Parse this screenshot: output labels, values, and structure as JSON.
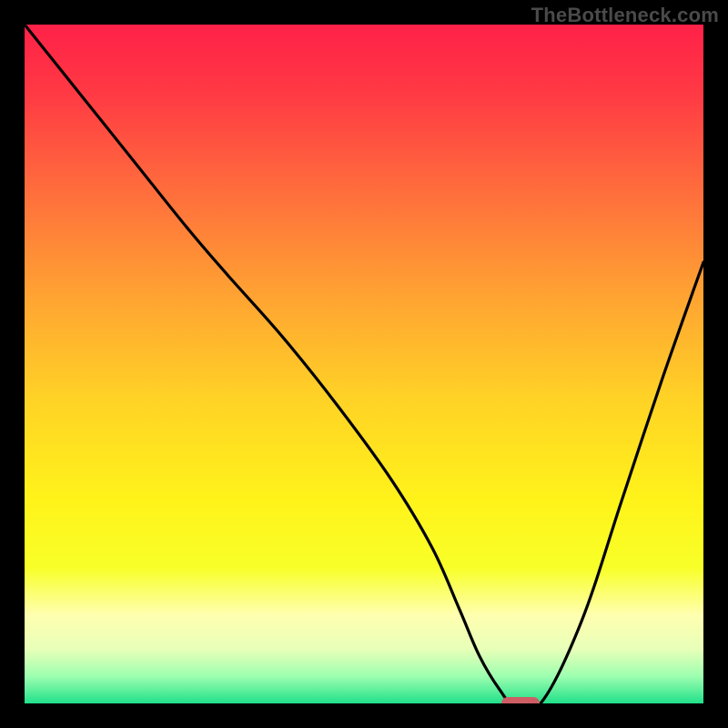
{
  "watermark": "TheBottleneck.com",
  "colors": {
    "background": "#000000",
    "curve_stroke": "#000000",
    "marker_fill": "#cd5e63",
    "watermark_text": "#4a4a4a"
  },
  "chart_data": {
    "type": "line",
    "title": "",
    "xlabel": "",
    "ylabel": "",
    "xlim": [
      0,
      100
    ],
    "ylim": [
      0,
      100
    ],
    "grid": false,
    "legend": false,
    "background_gradient": {
      "stops": [
        {
          "offset": 0.0,
          "color": "#ff2148"
        },
        {
          "offset": 0.1,
          "color": "#ff3944"
        },
        {
          "offset": 0.25,
          "color": "#ff6f3c"
        },
        {
          "offset": 0.4,
          "color": "#ffa332"
        },
        {
          "offset": 0.55,
          "color": "#ffd226"
        },
        {
          "offset": 0.7,
          "color": "#fff31a"
        },
        {
          "offset": 0.8,
          "color": "#f8ff28"
        },
        {
          "offset": 0.87,
          "color": "#ffffb0"
        },
        {
          "offset": 0.92,
          "color": "#e8ffb8"
        },
        {
          "offset": 0.96,
          "color": "#9dffb0"
        },
        {
          "offset": 1.0,
          "color": "#21e08a"
        }
      ]
    },
    "series": [
      {
        "name": "bottleneck-curve",
        "x": [
          0,
          8,
          16,
          24,
          30,
          38,
          46,
          54,
          60,
          64,
          67,
          70,
          72,
          76,
          82,
          88,
          94,
          100
        ],
        "y": [
          100,
          90,
          80,
          70,
          63,
          54,
          44,
          33,
          23,
          14,
          7,
          2,
          0,
          0,
          12,
          30,
          48,
          65
        ]
      }
    ],
    "marker": {
      "x": 73,
      "y": 0,
      "shape": "pill"
    }
  }
}
